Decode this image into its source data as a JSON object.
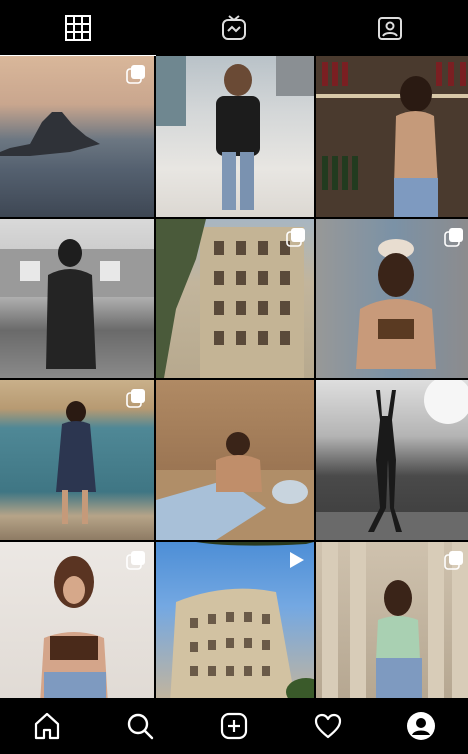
{
  "tabs": [
    {
      "icon": "grid-icon",
      "active": true
    },
    {
      "icon": "igtv-icon",
      "active": false
    },
    {
      "icon": "tagged-icon",
      "active": false
    }
  ],
  "posts": [
    {
      "type": "carousel"
    },
    {
      "type": "photo"
    },
    {
      "type": "photo"
    },
    {
      "type": "photo"
    },
    {
      "type": "carousel"
    },
    {
      "type": "carousel"
    },
    {
      "type": "carousel"
    },
    {
      "type": "photo"
    },
    {
      "type": "photo"
    },
    {
      "type": "carousel"
    },
    {
      "type": "video"
    },
    {
      "type": "carousel"
    }
  ],
  "bottom_nav": [
    {
      "icon": "home-icon"
    },
    {
      "icon": "search-icon"
    },
    {
      "icon": "new-post-icon"
    },
    {
      "icon": "activity-heart-icon"
    },
    {
      "icon": "profile-icon"
    }
  ]
}
